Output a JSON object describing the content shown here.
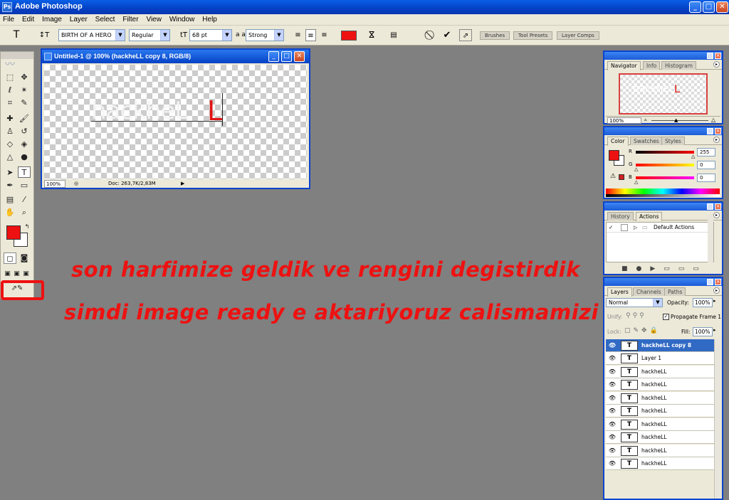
{
  "app": {
    "title": "Adobe Photoshop",
    "logo": "Ps"
  },
  "window_controls": {
    "minimize": "_",
    "maximize": "□",
    "close": "✕"
  },
  "menu": [
    "File",
    "Edit",
    "Image",
    "Layer",
    "Select",
    "Filter",
    "View",
    "Window",
    "Help"
  ],
  "options_bar": {
    "font_family": "BIRTH OF A HERO",
    "font_style": "Regular",
    "font_size": "68 pt",
    "aa_label": "a a",
    "anti_alias": "Strong",
    "text_color": "#ee1111",
    "palette_tabs": [
      "Brushes",
      "Tool Presets",
      "Layer Comps"
    ]
  },
  "document": {
    "title": "Untitled-1 @ 100% (hackheLL copy 8, RGB/8)",
    "canvas_text_white": "hackheL",
    "canvas_text_red": "L",
    "zoom": "100%",
    "doc_info": "Doc: 263,7K/2,83M"
  },
  "instructions": {
    "line1": "son harfimize geldik ve rengini degistirdik",
    "line2": "simdi image ready e aktariyoruz calismamizi"
  },
  "navigator": {
    "tabs": [
      "Navigator",
      "Info",
      "Histogram"
    ],
    "preview_text": "hackheL",
    "preview_red": "L",
    "zoom": "100%"
  },
  "color": {
    "tabs": [
      "Color",
      "Swatches",
      "Styles"
    ],
    "labels": [
      "R",
      "G",
      "B"
    ],
    "values": [
      "255",
      "0",
      "0"
    ],
    "fg": "#ee1111"
  },
  "actions": {
    "tabs": [
      "History",
      "Actions"
    ],
    "item": "Default Actions"
  },
  "layers": {
    "tabs": [
      "Layers",
      "Channels",
      "Paths"
    ],
    "blend_mode": "Normal",
    "opacity_label": "Opacity:",
    "opacity": "100%",
    "unify_label": "Unify:",
    "propagate": "Propagate Frame 1",
    "lock_label": "Lock:",
    "fill_label": "Fill:",
    "fill": "100%",
    "items": [
      {
        "name": "hackheLL copy 8",
        "selected": true
      },
      {
        "name": "Layer 1"
      },
      {
        "name": "hackheLL"
      },
      {
        "name": "hackheLL"
      },
      {
        "name": "hackheLL"
      },
      {
        "name": "hackheLL"
      },
      {
        "name": "hackheLL"
      },
      {
        "name": "hackheLL"
      },
      {
        "name": "hackheLL"
      },
      {
        "name": "hackheLL"
      }
    ]
  }
}
